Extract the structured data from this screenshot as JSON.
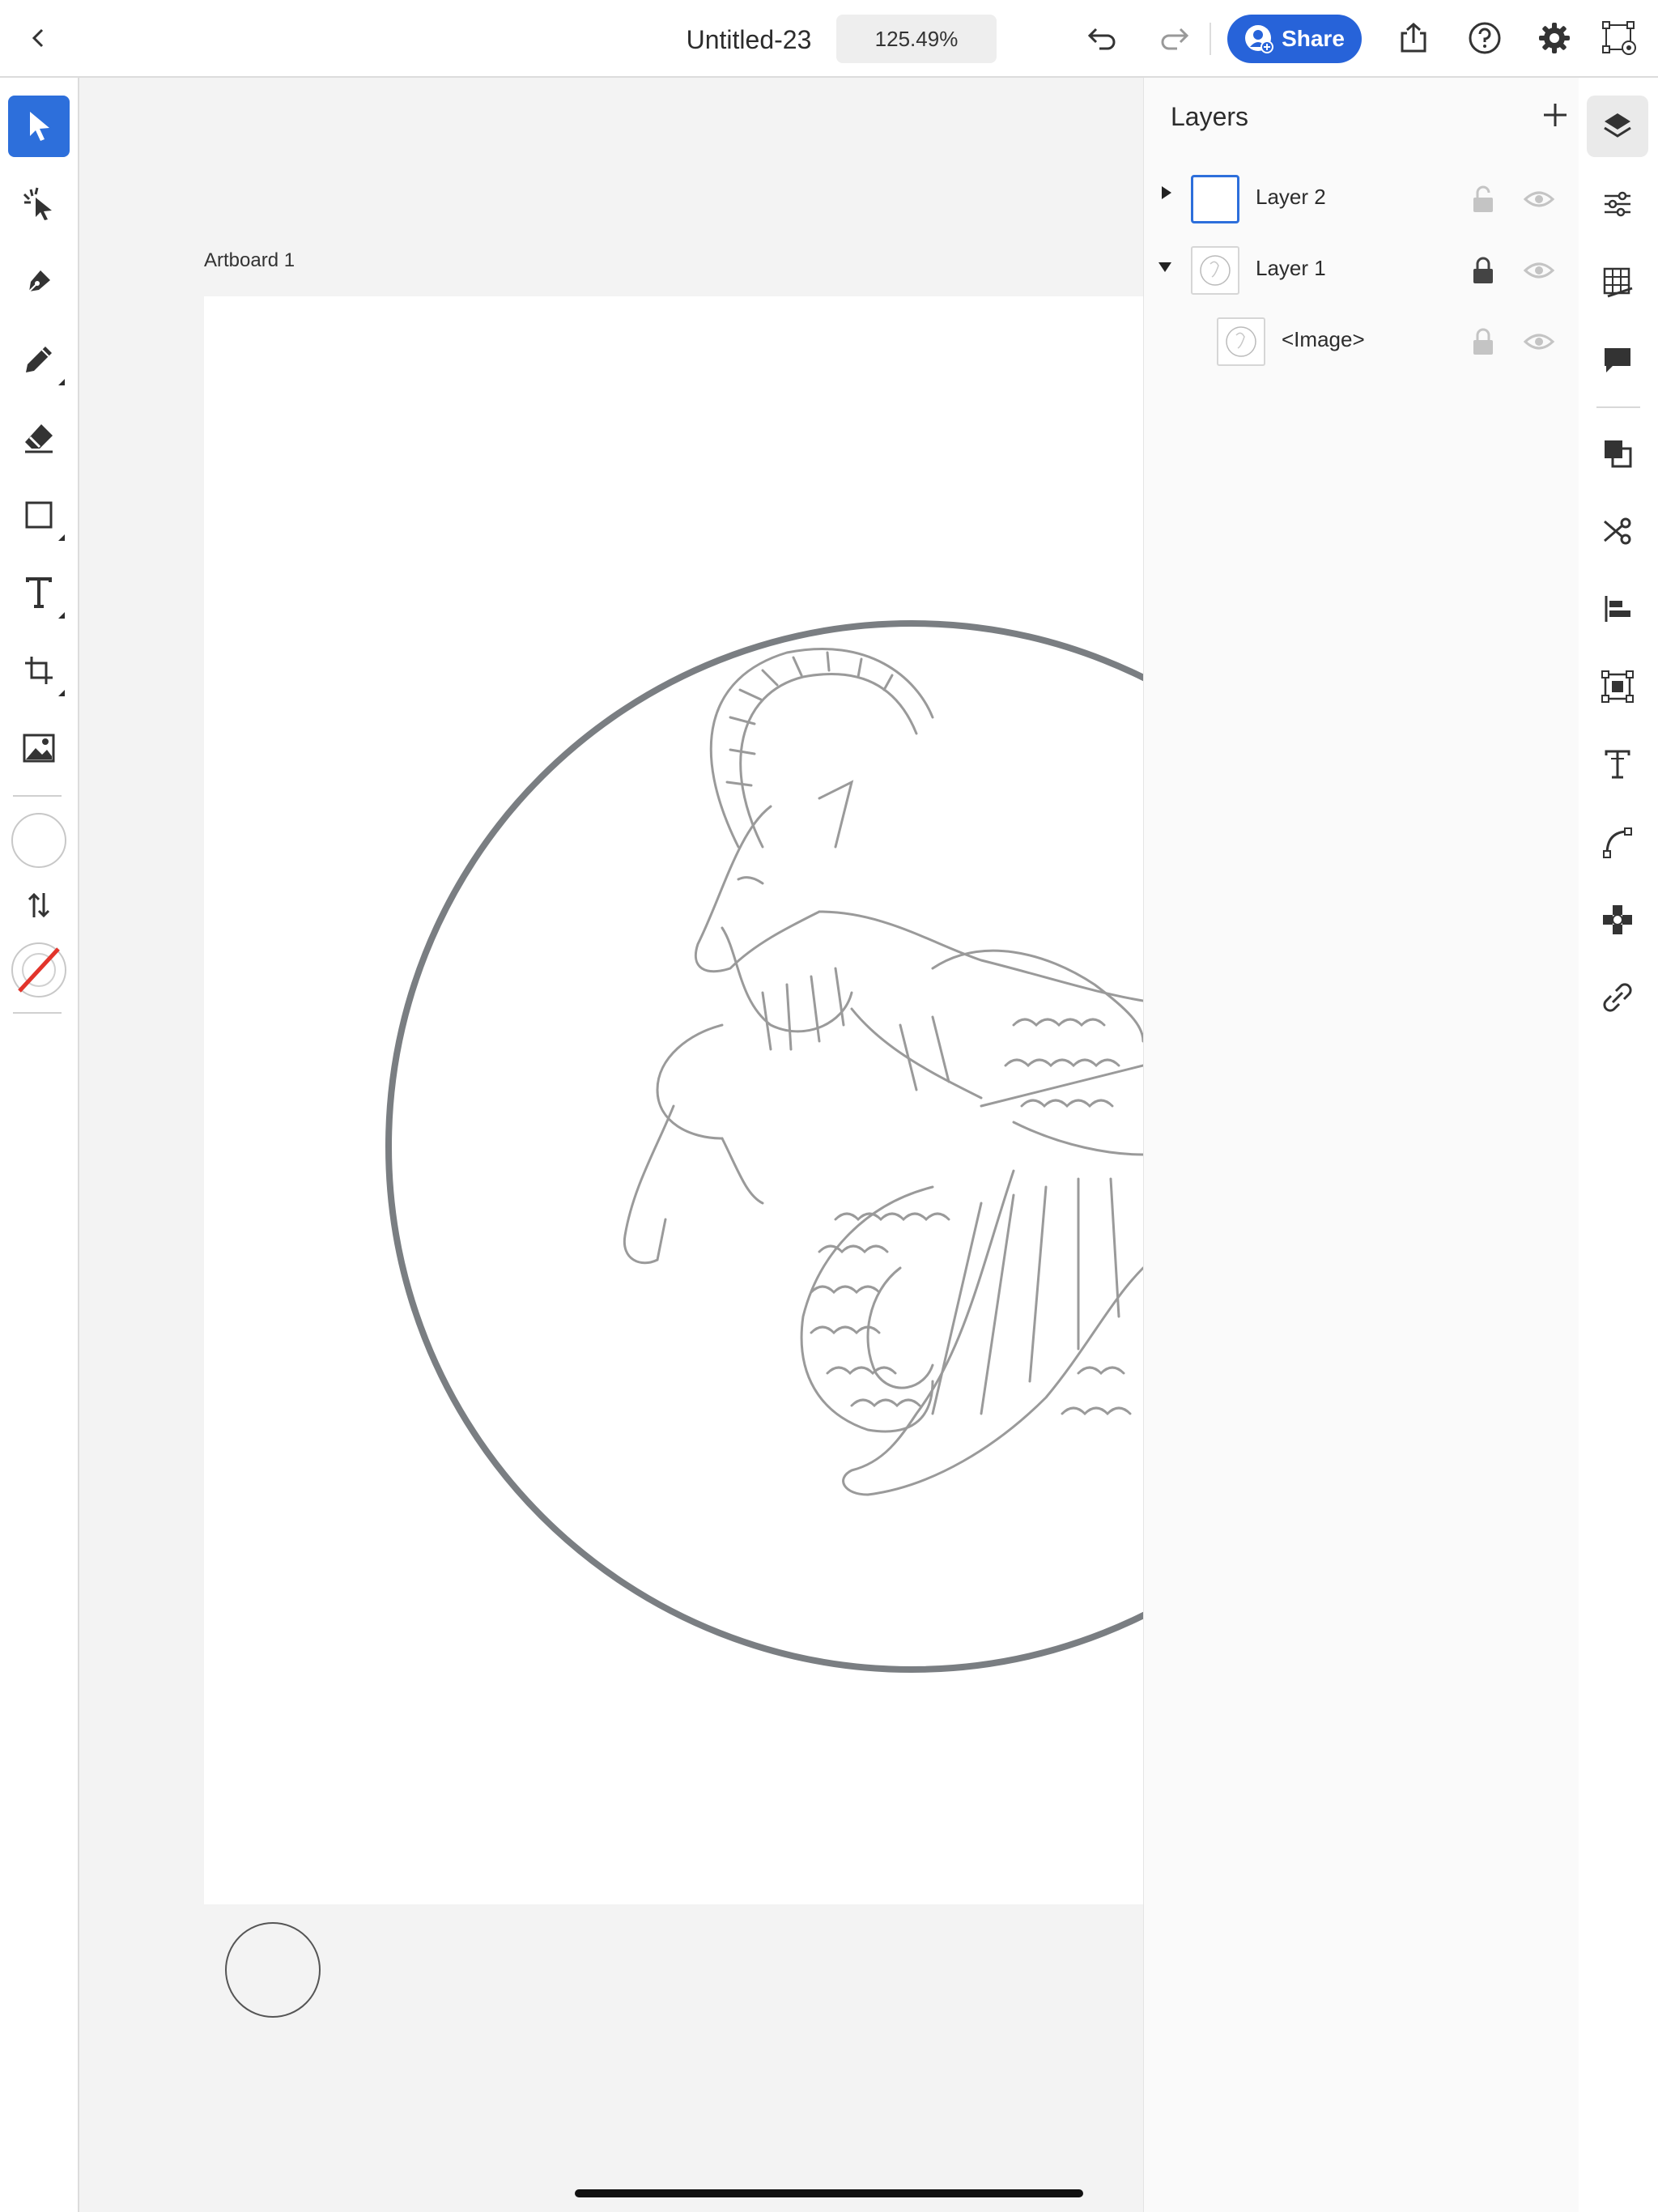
{
  "topbar": {
    "back_icon": "chevron-left-icon",
    "document_title": "Untitled-23",
    "zoom_level": "125.49%",
    "share_label": "Share",
    "icons": [
      "undo-icon",
      "redo-icon",
      "share-user-icon",
      "export-icon",
      "help-icon",
      "gear-icon",
      "bounding-box-icon"
    ]
  },
  "left_toolbar": {
    "tools": [
      "selection-arrow-icon",
      "direct-selection-icon",
      "pen-icon",
      "pencil-icon",
      "eraser-icon",
      "rectangle-icon",
      "text-icon",
      "transform-icon",
      "image-icon",
      "fill-swatch-icon",
      "swap-icon",
      "stroke-none-icon"
    ],
    "active_tool": "selection-arrow-icon"
  },
  "canvas": {
    "artboard_label": "Artboard 1"
  },
  "layers_panel": {
    "title": "Layers",
    "layers": [
      {
        "name": "Layer 2",
        "expanded": false,
        "locked": false,
        "visible": true,
        "selected": true
      },
      {
        "name": "Layer 1",
        "expanded": true,
        "locked": true,
        "visible": true,
        "selected": false
      },
      {
        "name": "<Image>",
        "expanded": false,
        "locked": true,
        "visible": true,
        "selected": false
      }
    ]
  },
  "right_toolbar": {
    "icons": [
      "layers-icon",
      "properties-icon",
      "grid-icon",
      "comment-icon",
      "pathfinder-icon",
      "scissors-icon",
      "align-icon",
      "transform-panel-icon",
      "type-panel-icon",
      "curve-icon",
      "symbol-icon",
      "link-icon"
    ],
    "active": "layers-icon"
  },
  "colors": {
    "accent": "#2d6fdb",
    "share_button": "#2763d9",
    "circle_stroke": "#7a7e82",
    "sketch": "#9a9a9a"
  }
}
